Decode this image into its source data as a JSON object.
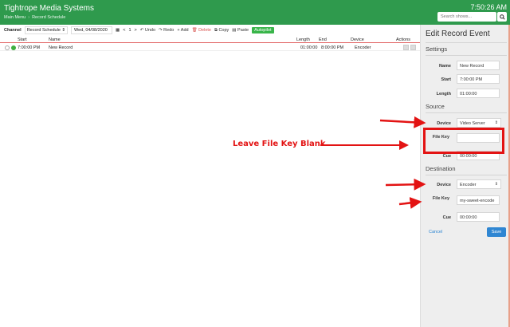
{
  "header": {
    "app_title": "Tightrope Media Systems",
    "breadcrumb": [
      "Main Menu",
      "Record Schedule"
    ],
    "clock": "7:50:26 AM",
    "search_placeholder": "Search shows...",
    "search_icon": "search-icon"
  },
  "toolbar": {
    "channel_label": "Channel",
    "channel_select": "Record Schedule ⇕",
    "date": "Wed, 04/08/2020",
    "calendar_icon": "calendar-icon",
    "prev": "<",
    "page": "1",
    "next": ">",
    "undo": "↶ Undo",
    "redo": "↷ Redo",
    "add": "+ Add",
    "delete": "🗑 Delete",
    "copy": "⧉ Copy",
    "paste": "▤ Paste",
    "autopilot": "Autopilot"
  },
  "grid": {
    "columns": {
      "start": "Start",
      "name": "Name",
      "length": "Length",
      "end": "End",
      "device": "Device",
      "actions": "Actions"
    },
    "rows": [
      {
        "start": "7:00:00 PM",
        "name": "New Record",
        "length": "01:00:00",
        "end": "8:00:00 PM",
        "device": "Encoder"
      }
    ]
  },
  "panel": {
    "title": "Edit Record Event",
    "settings_heading": "Settings",
    "name_label": "Name",
    "name_value": "New Record",
    "start_label": "Start",
    "start_value": "7:00:00 PM",
    "length_label": "Length",
    "length_value": "01:00:00",
    "source_heading": "Source",
    "source_device_label": "Device",
    "source_device_value": "Video Server",
    "source_filekey_label": "File Key",
    "source_filekey_value": "",
    "source_cue_label": "Cue",
    "source_cue_value": "00:00:00",
    "destination_heading": "Destination",
    "dest_device_label": "Device",
    "dest_device_value": "Encoder",
    "dest_filekey_label": "File Key",
    "dest_filekey_value": "my-sweet-encode",
    "dest_cue_label": "Cue",
    "dest_cue_value": "00:00:00",
    "cancel": "Cancel",
    "save": "Save"
  },
  "annotation": {
    "text": "Leave File Key Blank",
    "color": "#e31313"
  },
  "colors": {
    "header_green": "#2f9a4d",
    "autopilot_green": "#39b54a",
    "save_blue": "#2f86d2",
    "panel_bg": "#eeeeee"
  }
}
